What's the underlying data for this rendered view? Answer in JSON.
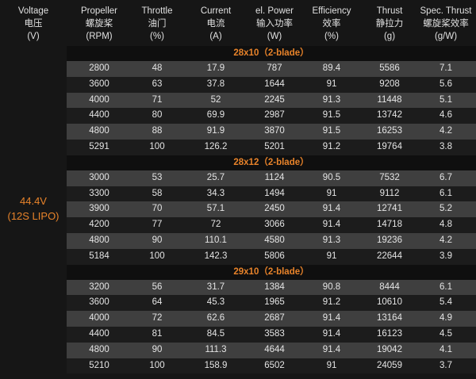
{
  "headers": [
    {
      "en": "Voltage",
      "zh": "电压",
      "unit": "(V)"
    },
    {
      "en": "Propeller",
      "zh": "螺旋桨",
      "unit": "(RPM)"
    },
    {
      "en": "Throttle",
      "zh": "油门",
      "unit": "(%)"
    },
    {
      "en": "Current",
      "zh": "电流",
      "unit": "(A)"
    },
    {
      "en": "el. Power",
      "zh": "输入功率",
      "unit": "(W)"
    },
    {
      "en": "Efficiency",
      "zh": "效率",
      "unit": "(%)"
    },
    {
      "en": "Thrust",
      "zh": "静拉力",
      "unit": "(g)"
    },
    {
      "en": "Spec. Thrust",
      "zh": "螺旋桨效率",
      "unit": "(g/W)"
    }
  ],
  "voltage": {
    "value": "44.4V",
    "battery": "(12S LIPO)"
  },
  "groups": [
    {
      "title": "28x10（2-blade）",
      "rows": [
        [
          "2800",
          "48",
          "17.9",
          "787",
          "89.4",
          "5586",
          "7.1"
        ],
        [
          "3600",
          "63",
          "37.8",
          "1644",
          "91",
          "9208",
          "5.6"
        ],
        [
          "4000",
          "71",
          "52",
          "2245",
          "91.3",
          "11448",
          "5.1"
        ],
        [
          "4400",
          "80",
          "69.9",
          "2987",
          "91.5",
          "13742",
          "4.6"
        ],
        [
          "4800",
          "88",
          "91.9",
          "3870",
          "91.5",
          "16253",
          "4.2"
        ],
        [
          "5291",
          "100",
          "126.2",
          "5201",
          "91.2",
          "19764",
          "3.8"
        ]
      ]
    },
    {
      "title": "28x12（2-blade）",
      "rows": [
        [
          "3000",
          "53",
          "25.7",
          "1124",
          "90.5",
          "7532",
          "6.7"
        ],
        [
          "3300",
          "58",
          "34.3",
          "1494",
          "91",
          "9112",
          "6.1"
        ],
        [
          "3900",
          "70",
          "57.1",
          "2450",
          "91.4",
          "12741",
          "5.2"
        ],
        [
          "4200",
          "77",
          "72",
          "3066",
          "91.4",
          "14718",
          "4.8"
        ],
        [
          "4800",
          "90",
          "110.1",
          "4580",
          "91.3",
          "19236",
          "4.2"
        ],
        [
          "5184",
          "100",
          "142.3",
          "5806",
          "91",
          "22644",
          "3.9"
        ]
      ]
    },
    {
      "title": "29x10（2-blade）",
      "rows": [
        [
          "3200",
          "56",
          "31.7",
          "1384",
          "90.8",
          "8444",
          "6.1"
        ],
        [
          "3600",
          "64",
          "45.3",
          "1965",
          "91.2",
          "10610",
          "5.4"
        ],
        [
          "4000",
          "72",
          "62.6",
          "2687",
          "91.4",
          "13164",
          "4.9"
        ],
        [
          "4400",
          "81",
          "84.5",
          "3583",
          "91.4",
          "16123",
          "4.5"
        ],
        [
          "4800",
          "90",
          "111.3",
          "4644",
          "91.4",
          "19042",
          "4.1"
        ],
        [
          "5210",
          "100",
          "158.9",
          "6502",
          "91",
          "24059",
          "3.7"
        ]
      ]
    }
  ]
}
